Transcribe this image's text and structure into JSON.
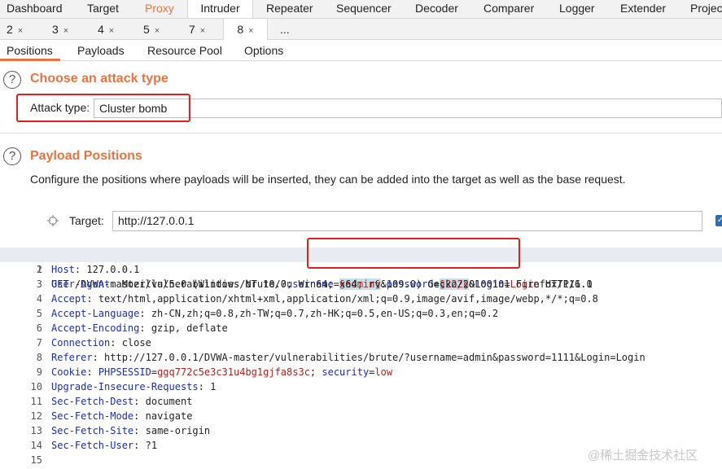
{
  "top_tabs": [
    "Dashboard",
    "Target",
    "Proxy",
    "Intruder",
    "Repeater",
    "Sequencer",
    "Decoder",
    "Comparer",
    "Logger",
    "Extender",
    "Project"
  ],
  "num_tabs": [
    "2",
    "3",
    "4",
    "5",
    "7",
    "8",
    "..."
  ],
  "close_glyph": "×",
  "sub_tabs": [
    "Positions",
    "Payloads",
    "Resource Pool",
    "Options"
  ],
  "attack": {
    "title": "Choose an attack type",
    "label": "Attack type:",
    "value": "Cluster bomb"
  },
  "positions": {
    "title": "Payload Positions",
    "description": "Configure the positions where payloads will be inserted, they can be added into the target as well as the base request.",
    "target_label": "Target:",
    "target_value": "http://127.0.0.1"
  },
  "help_glyph": "?",
  "request": {
    "line1": {
      "prefix": "GET /DVWA-master/vulnerabilities/brute/?",
      "p1": "username",
      "eq1": "=",
      "pay1": "§admin§",
      "amp1": "&",
      "p2": "password",
      "eq2": "=",
      "pay2": "§222§",
      "amp2": "&",
      "p3": "Login",
      "eq3": "=",
      "v3": "Login",
      "suffix": " HTTP/1.1"
    },
    "headers": [
      {
        "name": "Host",
        "value": " 127.0.0.1"
      },
      {
        "name": "User-Agent",
        "value": " Mozilla/5.0 (Windows NT 10.0; Win64; x64; rv:109.0) Gecko/20100101 Firefox/116.0"
      },
      {
        "name": "Accept",
        "value": " text/html,application/xhtml+xml,application/xml;q=0.9,image/avif,image/webp,*/*;q=0.8"
      },
      {
        "name": "Accept-Language",
        "value": " zh-CN,zh;q=0.8,zh-TW;q=0.7,zh-HK;q=0.5,en-US;q=0.3,en;q=0.2"
      },
      {
        "name": "Accept-Encoding",
        "value": " gzip, deflate"
      },
      {
        "name": "Connection",
        "value": " close"
      },
      {
        "name": "Referer",
        "value": " http://127.0.0.1/DVWA-master/vulnerabilities/brute/?username=admin&password=1111&Login=Login"
      }
    ],
    "cookie": {
      "name": "Cookie",
      "k1": "PHPSESSID",
      "v1": "ggq772c5e3c31u4bg1gjfa8s3c",
      "sep": "; ",
      "k2": "security",
      "v2": "low"
    },
    "headers2": [
      {
        "name": "Upgrade-Insecure-Requests",
        "value": " 1"
      },
      {
        "name": "Sec-Fetch-Dest",
        "value": " document"
      },
      {
        "name": "Sec-Fetch-Mode",
        "value": " navigate"
      },
      {
        "name": "Sec-Fetch-Site",
        "value": " same-origin"
      },
      {
        "name": "Sec-Fetch-User",
        "value": " ?1"
      }
    ],
    "line_numbers": [
      "1",
      "2",
      "3",
      "4",
      "5",
      "6",
      "7",
      "8",
      "9",
      "10",
      "11",
      "12",
      "13",
      "14",
      "15"
    ]
  },
  "watermark": "@稀土掘金技术社区",
  "colors": {
    "accent": "#e87442",
    "highlight_box": "#e02020",
    "param_key": "#1f2fa8",
    "param_value": "#b22222",
    "payload_bg": "#c4e0e8"
  }
}
